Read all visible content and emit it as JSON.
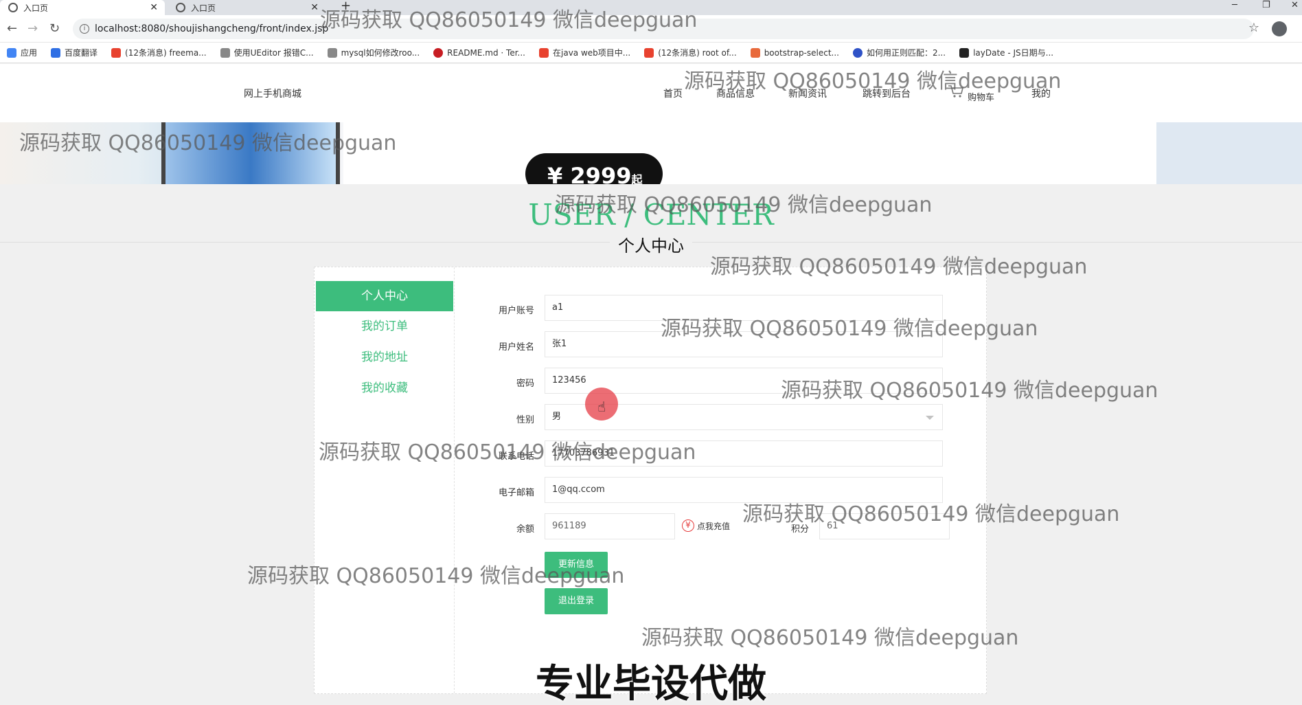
{
  "browser": {
    "tabs": [
      {
        "title": "入口页",
        "active": true
      },
      {
        "title": "入口页",
        "active": false
      }
    ],
    "new_tab": "+",
    "url": "localhost:8080/shoujishangcheng/front/index.jsp",
    "bookmarks": [
      {
        "label": "应用",
        "color": "#4285f4"
      },
      {
        "label": "百度翻译",
        "color": "#2f6fe4"
      },
      {
        "label": "(12条消息) freema...",
        "color": "#e8422f"
      },
      {
        "label": "使用UEditor 报错C...",
        "color": "#666666"
      },
      {
        "label": "mysql如何修改roo...",
        "color": "#666666"
      },
      {
        "label": "README.md · Ter...",
        "color": "#c71d23"
      },
      {
        "label": "在java web项目中...",
        "color": "#e8422f"
      },
      {
        "label": "(12条消息) root of...",
        "color": "#e8422f"
      },
      {
        "label": "bootstrap-select...",
        "color": "#e86a3c"
      },
      {
        "label": "如何用正则匹配：2...",
        "color": "#2f52c7"
      },
      {
        "label": "layDate - JS日期与...",
        "color": "#222222"
      }
    ]
  },
  "site": {
    "brand": "网上手机商城",
    "nav": [
      "首页",
      "商品信息",
      "新闻资讯",
      "跳转到后台",
      "购物车",
      "我的"
    ]
  },
  "banner": {
    "price": "¥ 2999",
    "price_suffix": "起"
  },
  "section": {
    "title_en": "USER / CENTER",
    "title_cn": "个人中心"
  },
  "sidebar": {
    "items": [
      {
        "label": "个人中心",
        "active": true
      },
      {
        "label": "我的订单",
        "active": false
      },
      {
        "label": "我的地址",
        "active": false
      },
      {
        "label": "我的收藏",
        "active": false
      }
    ]
  },
  "form": {
    "account": {
      "label": "用户账号",
      "value": "a1"
    },
    "name": {
      "label": "用户姓名",
      "value": "张1"
    },
    "password": {
      "label": "密码",
      "value": "123456"
    },
    "gender": {
      "label": "性别",
      "value": "男"
    },
    "phone": {
      "label": "联系电话",
      "value": "17703786931"
    },
    "email": {
      "label": "电子邮箱",
      "value": "1@qq.ccom"
    },
    "balance": {
      "label": "余额",
      "value": "961189"
    },
    "recharge": "点我充值",
    "points": {
      "label": "积分",
      "value": "61"
    },
    "update_button": "更新信息",
    "logout_button": "退出登录"
  },
  "overlay": {
    "watermark": "源码获取 QQ86050149 微信deepguan",
    "bottom_banner": "专业毕设代做"
  },
  "colors": {
    "accent": "#3dbd7d",
    "recharge_icon": "#e63c3c"
  }
}
